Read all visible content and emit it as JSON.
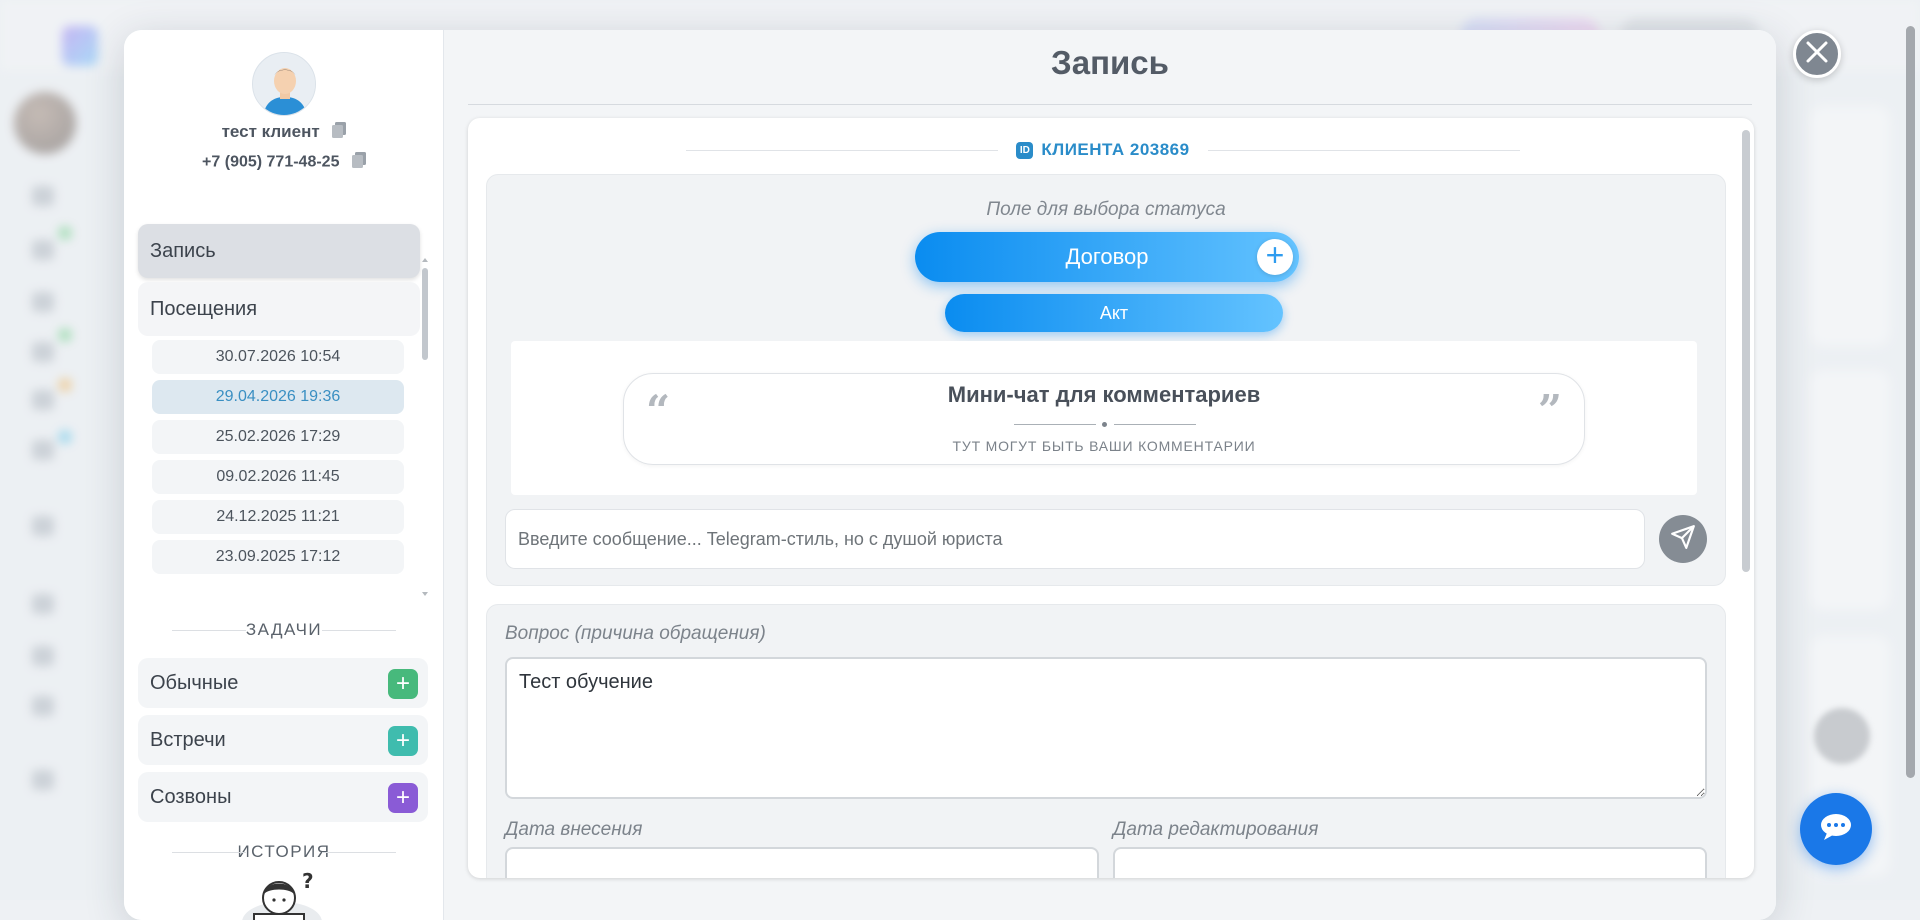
{
  "modal": {
    "title": "Запись",
    "close_icon": "close-icon"
  },
  "client": {
    "name": "тест клиент",
    "phone": "+7 (905) 771-48-25",
    "id_badge": "ID",
    "id_label": "КЛИЕНТА 203869"
  },
  "left_menu": {
    "items": [
      {
        "label": "Запись",
        "active": true
      },
      {
        "label": "Посещения",
        "active": false
      }
    ],
    "visits": [
      {
        "label": "30.07.2026 10:54",
        "selected": false
      },
      {
        "label": "29.04.2026 19:36",
        "selected": true
      },
      {
        "label": "25.02.2026 17:29",
        "selected": false
      },
      {
        "label": "09.02.2026 11:45",
        "selected": false
      },
      {
        "label": "24.12.2025 11:21",
        "selected": false
      },
      {
        "label": "23.09.2025 17:12",
        "selected": false
      }
    ]
  },
  "tasks": {
    "section_title": "ЗАДАЧИ",
    "items": [
      {
        "label": "Обычные",
        "color": "#47b97c"
      },
      {
        "label": "Встречи",
        "color": "#3fbcae"
      },
      {
        "label": "Созвоны",
        "color": "#8a5bd6"
      }
    ]
  },
  "history": {
    "section_title": "ИСТОРИЯ"
  },
  "status": {
    "hint": "Поле для выбора статуса",
    "primary": "Договор",
    "secondary": "Акт"
  },
  "mini_chat": {
    "title": "Мини-чат для комментариев",
    "subtitle": "ТУТ МОГУТ БЫТЬ ВАШИ КОММЕНТАРИИ",
    "input_placeholder": "Введите сообщение... Telegram-стиль, но с душой юриста"
  },
  "question": {
    "label": "Вопрос (причина обращения)",
    "value": "Тест обучение"
  },
  "dates": {
    "created_label": "Дата внесения",
    "edited_label": "Дата редактирования"
  },
  "colors": {
    "accent": "#2a8cc9",
    "status_gradient_start": "#0a8cf0",
    "status_gradient_end": "#64c3ff",
    "fab": "#1a78e8"
  }
}
